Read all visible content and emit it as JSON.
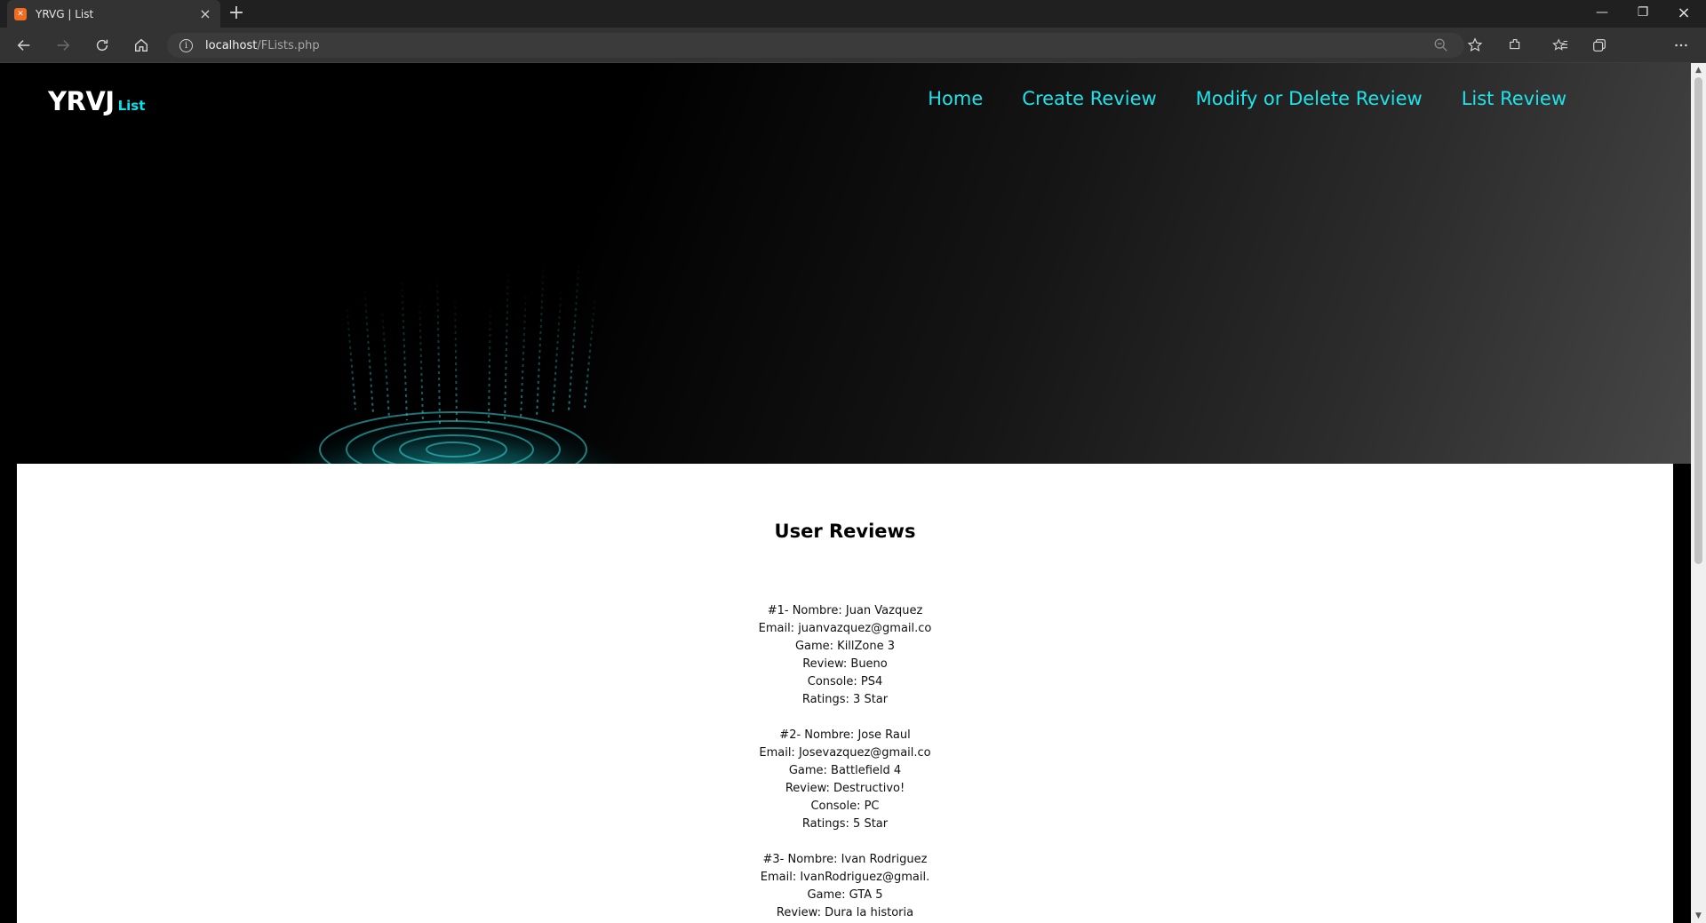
{
  "browser": {
    "tab_title": "YRVG | List",
    "tab_favicon_glyph": "✕",
    "url_host": "localhost",
    "url_path": "/FLists.php"
  },
  "site": {
    "logo_main": "YRVJ",
    "logo_sub": "List",
    "nav": [
      {
        "label": "Home"
      },
      {
        "label": "Create Review"
      },
      {
        "label": "Modify or Delete Review"
      },
      {
        "label": "List Review"
      }
    ],
    "accent_color": "#1fe3ea"
  },
  "main": {
    "title": "User Reviews",
    "reviews": [
      {
        "header": "#1- Nombre: Juan Vazquez",
        "email": "Email: juanvazquez@gmail.co",
        "game": "Game: KillZone 3",
        "review": "Review: Bueno",
        "console": "Console: PS4",
        "ratings": "Ratings: 3 Star"
      },
      {
        "header": "#2- Nombre: Jose Raul",
        "email": "Email: Josevazquez@gmail.co",
        "game": "Game: Battlefield 4",
        "review": "Review: Destructivo!",
        "console": "Console: PC",
        "ratings": "Ratings: 5 Star"
      },
      {
        "header": "#3- Nombre: Ivan Rodriguez",
        "email": "Email: IvanRodriguez@gmail.",
        "game": "Game: GTA 5",
        "review": "Review: Dura la historia"
      }
    ]
  }
}
